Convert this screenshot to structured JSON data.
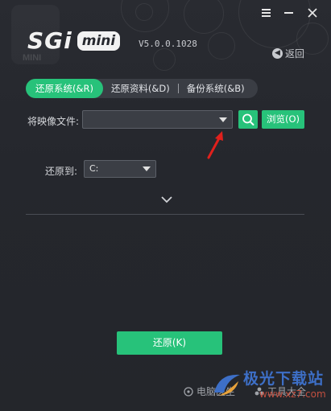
{
  "window": {
    "controls": [
      "menu-icon",
      "minimize-icon",
      "close-icon"
    ]
  },
  "header": {
    "logo_main": "SGi",
    "logo_badge": "mini",
    "logo_ghost_text": "MINI",
    "version": "V5.0.0.1028",
    "back_label": "返回"
  },
  "tabs": [
    {
      "label": "还原系统(&R)",
      "active": true
    },
    {
      "label": "还原资料(&D)",
      "active": false
    },
    {
      "label": "备份系统(&B)",
      "active": false
    }
  ],
  "image_file": {
    "label": "将映像文件:",
    "value": "",
    "browse_label": "浏览(O)"
  },
  "restore_to": {
    "label": "还原到:",
    "selected": "C:"
  },
  "actions": {
    "restore_label": "还原(K)"
  },
  "footer": {
    "link1": "电脑医生",
    "link2": "工具大全"
  },
  "watermark": {
    "text": "极光下载站",
    "url": "www.xz7.com"
  },
  "colors": {
    "accent": "#27c27a",
    "background": "#24262c",
    "annotation": "#e0201c"
  }
}
